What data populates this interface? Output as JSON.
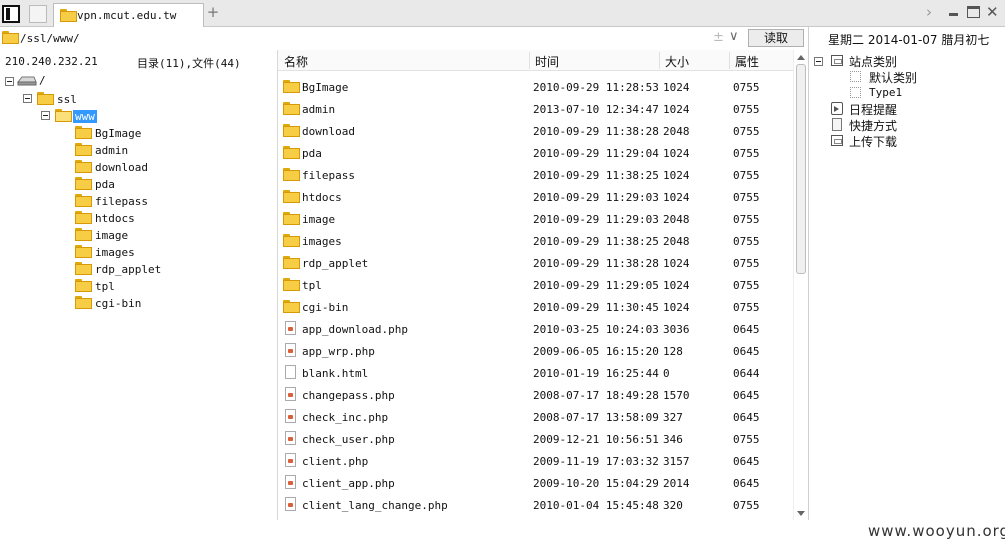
{
  "tabbar": {
    "tab_title": "vpn.mcut.edu.tw",
    "add_tab": "+",
    "chevron": "›",
    "close": "✕"
  },
  "address": {
    "path": "/ssl/www/",
    "read_button": "读取",
    "pm_icon": "±",
    "dropdown_icon": "∨"
  },
  "info": {
    "ip": "210.240.232.21",
    "counts": "目录(11),文件(44)"
  },
  "tree": {
    "root": "/",
    "ssl": "ssl",
    "www": "www",
    "children": [
      "BgImage",
      "admin",
      "download",
      "pda",
      "filepass",
      "htdocs",
      "image",
      "images",
      "rdp_applet",
      "tpl",
      "cgi-bin"
    ]
  },
  "list": {
    "headers": {
      "name": "名称",
      "time": "时间",
      "size": "大小",
      "perm": "属性"
    },
    "rows": [
      {
        "type": "folder",
        "name": "BgImage",
        "time": "2010-09-29 11:28:53",
        "size": "1024",
        "perm": "0755"
      },
      {
        "type": "folder",
        "name": "admin",
        "time": "2013-07-10 12:34:47",
        "size": "1024",
        "perm": "0755"
      },
      {
        "type": "folder",
        "name": "download",
        "time": "2010-09-29 11:38:28",
        "size": "2048",
        "perm": "0755"
      },
      {
        "type": "folder",
        "name": "pda",
        "time": "2010-09-29 11:29:04",
        "size": "1024",
        "perm": "0755"
      },
      {
        "type": "folder",
        "name": "filepass",
        "time": "2010-09-29 11:38:25",
        "size": "1024",
        "perm": "0755"
      },
      {
        "type": "folder",
        "name": "htdocs",
        "time": "2010-09-29 11:29:03",
        "size": "1024",
        "perm": "0755"
      },
      {
        "type": "folder",
        "name": "image",
        "time": "2010-09-29 11:29:03",
        "size": "2048",
        "perm": "0755"
      },
      {
        "type": "folder",
        "name": "images",
        "time": "2010-09-29 11:38:25",
        "size": "2048",
        "perm": "0755"
      },
      {
        "type": "folder",
        "name": "rdp_applet",
        "time": "2010-09-29 11:38:28",
        "size": "1024",
        "perm": "0755"
      },
      {
        "type": "folder",
        "name": "tpl",
        "time": "2010-09-29 11:29:05",
        "size": "1024",
        "perm": "0755"
      },
      {
        "type": "folder",
        "name": "cgi-bin",
        "time": "2010-09-29 11:30:45",
        "size": "1024",
        "perm": "0755"
      },
      {
        "type": "php",
        "name": "app_download.php",
        "time": "2010-03-25 10:24:03",
        "size": "3036",
        "perm": "0645"
      },
      {
        "type": "php",
        "name": "app_wrp.php",
        "time": "2009-06-05 16:15:20",
        "size": "128",
        "perm": "0645"
      },
      {
        "type": "html",
        "name": "blank.html",
        "time": "2010-01-19 16:25:44",
        "size": "0",
        "perm": "0644"
      },
      {
        "type": "php",
        "name": "changepass.php",
        "time": "2008-07-17 18:49:28",
        "size": "1570",
        "perm": "0645"
      },
      {
        "type": "php",
        "name": "check_inc.php",
        "time": "2008-07-17 13:58:09",
        "size": "327",
        "perm": "0645"
      },
      {
        "type": "php",
        "name": "check_user.php",
        "time": "2009-12-21 10:56:51",
        "size": "346",
        "perm": "0755"
      },
      {
        "type": "php",
        "name": "client.php",
        "time": "2009-11-19 17:03:32",
        "size": "3157",
        "perm": "0645"
      },
      {
        "type": "php",
        "name": "client_app.php",
        "time": "2009-10-20 15:04:29",
        "size": "2014",
        "perm": "0645"
      },
      {
        "type": "php",
        "name": "client_lang_change.php",
        "time": "2010-01-04 15:45:48",
        "size": "320",
        "perm": "0755"
      }
    ]
  },
  "right_panel": {
    "date": "星期二 2014-01-07 腊月初七",
    "site_category": "站点类别",
    "default_category": "默认类别",
    "type1": "Type1",
    "schedule": "日程提醒",
    "shortcuts": "快捷方式",
    "upload_download": "上传下载"
  },
  "watermark": "www.wooyun.org",
  "colors": {
    "selection": "#3399ff",
    "folder": "#f6cd44",
    "php": "#d9603b"
  }
}
